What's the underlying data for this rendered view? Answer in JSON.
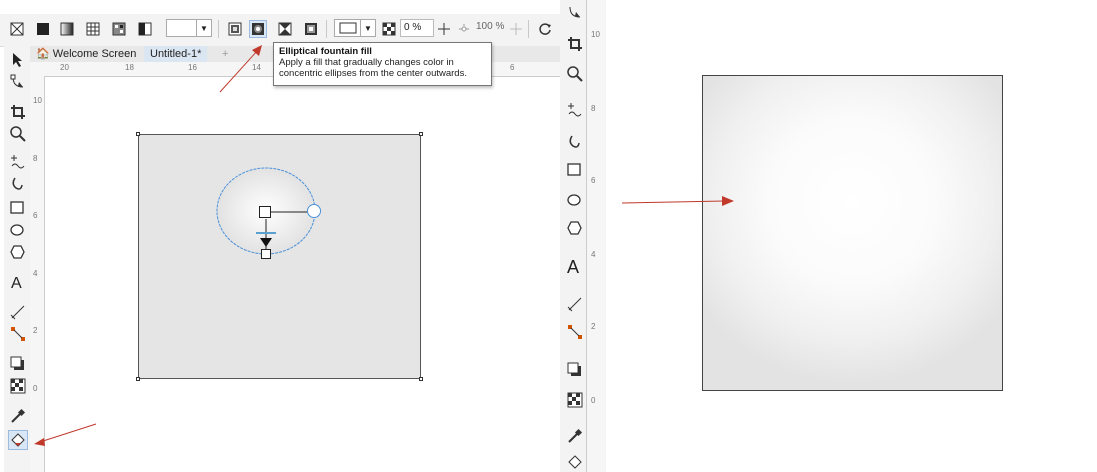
{
  "toolbar": {
    "transparency_pct": "0 %",
    "midpoint_pct": "100 %",
    "fill_types": [
      "no-fill",
      "uniform-fill",
      "fountain-fill",
      "vector-pattern",
      "bitmap-pattern",
      "two-color-pattern"
    ],
    "fountain_types": [
      "linear",
      "elliptical",
      "conical",
      "rectangular"
    ],
    "selected_fountain": "elliptical"
  },
  "tabs": [
    {
      "label": "Welcome Screen",
      "icon": "home-icon"
    },
    {
      "label": "Untitled-1*"
    },
    {
      "label": "+"
    }
  ],
  "tooltip": {
    "title": "Elliptical fountain fill",
    "line1": "Apply a fill that gradually changes color in",
    "line2": "concentric ellipses from the center outwards."
  },
  "ruler": {
    "h_ticks": [
      "20",
      "18",
      "16",
      "14",
      "6"
    ],
    "v_ticks": [
      "10",
      "8",
      "6",
      "4",
      "2",
      "0"
    ],
    "mid_ticks": [
      "10",
      "8",
      "6",
      "4",
      "2",
      "0"
    ]
  },
  "colors": {
    "accent": "#c0392b",
    "selection": "#d8e6f5",
    "ellipse_handle": "#4a90d9",
    "page_fill": "#e5e5e5"
  }
}
